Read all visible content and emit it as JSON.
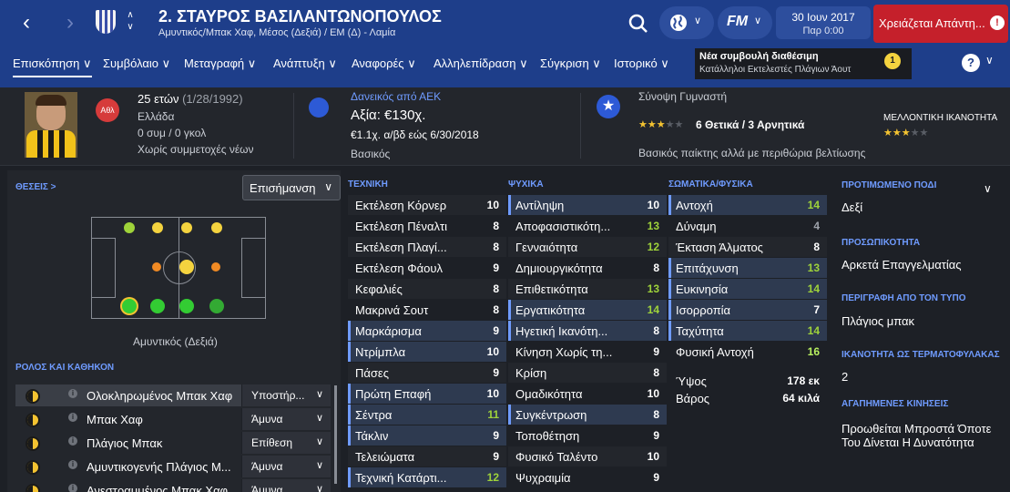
{
  "header": {
    "player_title": "2. ΣΤΑΥΡΟΣ ΒΑΣΙΛΑΝΤΩΝΟΠΟΥΛΟΣ",
    "player_subtitle": "Αμυντικός/Μπακ Χαφ, Μέσος (Δεξιά) / ΕΜ (Δ) - Λαμία",
    "date_main": "30 Ιουν 2017",
    "date_sub": "Παρ 0:00",
    "alert": "Χρειάζεται Απάντη...",
    "alert_badge": "!",
    "fm_logo": "FM",
    "tip_title": "Νέα συμβουλή διαθέσιμη",
    "tip_text": "Κατάλληλοι Εκτελεστές Πλάγιων Άουτ",
    "tip_badge": "1"
  },
  "tabs": [
    "Επισκόπηση",
    "Συμβόλαιο",
    "Μεταγραφή",
    "Ανάπτυξη",
    "Αναφορές",
    "Αλληλεπίδραση",
    "Σύγκριση",
    "Ιστορικό"
  ],
  "summary": {
    "age": "25 ετών",
    "dob": "(1/28/1992)",
    "nation": "Ελλάδα",
    "caps": "0 συμ / 0 γκολ",
    "youth": "Χωρίς συμμετοχές νέων",
    "club_badge": "Αθλ",
    "loan_from": "Δανεικός από ΑΕΚ",
    "value": "Αξία: €130χ.",
    "wage": "€1.1χ. α/βδ εώς 6/30/2018",
    "status": "Βασικός",
    "coach_label": "Σύνοψη Γυμναστή",
    "coach_summary": "6 Θετικά / 3 Αρνητικά",
    "coach_stars": 3,
    "coach_text": "Βασικός παίκτης αλλά με περιθώρια βελτίωσης",
    "potential_label": "ΜΕΛΛΟΝΤΙΚΗ ΙΚΑΝΟΤΗΤΑ",
    "potential_stars": 3
  },
  "left": {
    "positions_label": "ΘΕΣΕΙΣ >",
    "highlight_label": "Επισήμανση",
    "position_caption": "Αμυντικός (Δεξιά)",
    "roles_label": "ΡΟΛΟΣ ΚΑΙ ΚΑΘΗΚΟΝ",
    "roles": [
      {
        "name": "Ολοκληρωμένος Μπακ Χαφ",
        "duty": "Υποστήρ..."
      },
      {
        "name": "Μπακ Χαφ",
        "duty": "Άμυνα"
      },
      {
        "name": "Πλάγιος Μπακ",
        "duty": "Επίθεση"
      },
      {
        "name": "Αμυντικογενής Πλάγιος Μ...",
        "duty": "Άμυνα"
      },
      {
        "name": "Ανεστραμμένος Μπακ Χαφ",
        "duty": "Άμυνα"
      }
    ]
  },
  "colors": {
    "green": "#7ed957",
    "yellow": "#f4d33f",
    "orange": "#f08a24",
    "white": "#ffffff",
    "grey": "#9ea3ab",
    "accent": "#6f9bff"
  },
  "attributes": {
    "technical_label": "ΤΕΧΝΙΚΗ",
    "technical": [
      {
        "n": "Εκτέλεση Κόρνερ",
        "v": "10"
      },
      {
        "n": "Εκτέλεση Πέναλτι",
        "v": "8"
      },
      {
        "n": "Εκτέλεση Πλαγί...",
        "v": "8"
      },
      {
        "n": "Εκτέλεση Φάουλ",
        "v": "9"
      },
      {
        "n": "Κεφαλιές",
        "v": "8"
      },
      {
        "n": "Μακρινά Σουτ",
        "v": "8"
      },
      {
        "n": "Μαρκάρισμα",
        "v": "9"
      },
      {
        "n": "Ντρίμπλα",
        "v": "10"
      },
      {
        "n": "Πάσες",
        "v": "9"
      },
      {
        "n": "Πρώτη Επαφή",
        "v": "10"
      },
      {
        "n": "Σέντρα",
        "v": "11"
      },
      {
        "n": "Τάκλιν",
        "v": "9"
      },
      {
        "n": "Τελειώματα",
        "v": "9"
      },
      {
        "n": "Τεχνική Κατάρτι...",
        "v": "12"
      }
    ],
    "mental_label": "ΨΥΧΙΚΑ",
    "mental": [
      {
        "n": "Αντίληψη",
        "v": "10"
      },
      {
        "n": "Αποφασιστικότη...",
        "v": "13"
      },
      {
        "n": "Γενναιότητα",
        "v": "12"
      },
      {
        "n": "Δημιουργικότητα",
        "v": "8"
      },
      {
        "n": "Επιθετικότητα",
        "v": "13"
      },
      {
        "n": "Εργατικότητα",
        "v": "14"
      },
      {
        "n": "Ηγετική Ικανότη...",
        "v": "8"
      },
      {
        "n": "Κίνηση Χωρίς τη...",
        "v": "9"
      },
      {
        "n": "Κρίση",
        "v": "8"
      },
      {
        "n": "Ομαδικότητα",
        "v": "10"
      },
      {
        "n": "Συγκέντρωση",
        "v": "8"
      },
      {
        "n": "Τοποθέτηση",
        "v": "9"
      },
      {
        "n": "Φυσικό Ταλέντο",
        "v": "10"
      },
      {
        "n": "Ψυχραιμία",
        "v": "9"
      }
    ],
    "physical_label": "ΣΩΜΑΤΙΚΑ/ΦΥΣΙΚΑ",
    "physical": [
      {
        "n": "Αντοχή",
        "v": "14"
      },
      {
        "n": "Δύναμη",
        "v": "4"
      },
      {
        "n": "Έκταση Άλματος",
        "v": "8"
      },
      {
        "n": "Επιτάχυνση",
        "v": "13"
      },
      {
        "n": "Ευκινησία",
        "v": "14"
      },
      {
        "n": "Ισορροπία",
        "v": "7"
      },
      {
        "n": "Ταχύτητα",
        "v": "14"
      },
      {
        "n": "Φυσική Αντοχή",
        "v": "16"
      }
    ],
    "height_label": "Ύψος",
    "height": "178 εκ",
    "weight_label": "Βάρος",
    "weight": "64 κιλά"
  },
  "right": {
    "foot_label": "ΠΡΟΤΙΜΩΜΕΝΟ ΠΟΔΙ",
    "foot": "Δεξί",
    "personality_label": "ΠΡΟΣΩΠΙΚΟΤΗΤΑ",
    "personality": "Αρκετά Επαγγελματίας",
    "media_label": "ΠΕΡΙΓΡΑΦΗ ΑΠΟ ΤΟΝ ΤΥΠΟ",
    "media": "Πλάγιος μπακ",
    "gk_label": "ΙΚΑΝΟΤΗΤΑ ΩΣ ΤΕΡΜΑΤΟΦΥΛΑΚΑΣ",
    "gk": "2",
    "moves_label": "ΑΓΑΠΗΜΕΝΕΣ ΚΙΝΗΣΕΙΣ",
    "moves_line1": "Προωθείται Μπροστά Όποτε",
    "moves_line2": "Του Δίνεται Η Δυνατότητα"
  }
}
